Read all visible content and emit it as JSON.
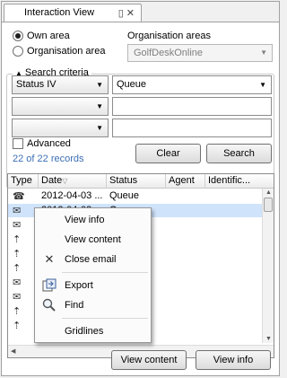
{
  "panel": {
    "tab_title": "Interaction View",
    "tab_pin_icon": "pin-icon",
    "tab_close_icon": "close-icon"
  },
  "area": {
    "own_area_label": "Own area",
    "organisation_area_label": "Organisation area",
    "selected": "own_area",
    "organisation_areas_label": "Organisation areas",
    "organisation_areas_value": "GolfDeskOnline"
  },
  "criteria": {
    "title": "Search criteria",
    "rows": [
      {
        "field": "Status IV",
        "value": "Queue"
      },
      {
        "field": "",
        "value": ""
      },
      {
        "field": "",
        "value": ""
      }
    ],
    "advanced_label": "Advanced",
    "advanced_checked": false,
    "records_text": "22 of 22 records",
    "clear_label": "Clear",
    "search_label": "Search"
  },
  "table": {
    "columns": [
      "Type",
      "Date",
      "Status",
      "Agent",
      "Identific..."
    ],
    "sort_column": "Date",
    "rows": [
      {
        "type_icon": "phone-icon",
        "date": "2012-04-03 ...",
        "status": "Queue",
        "selected": false
      },
      {
        "type_icon": "email-icon",
        "date": "2012-04-03",
        "status": "Queue",
        "selected": true
      },
      {
        "type_icon": "email-icon",
        "date": "",
        "status": "",
        "selected": false
      },
      {
        "type_icon": "incoming-icon",
        "date": "",
        "status": "",
        "selected": false
      },
      {
        "type_icon": "incoming-icon",
        "date": "",
        "status": "",
        "selected": false
      },
      {
        "type_icon": "incoming-icon",
        "date": "",
        "status": "",
        "selected": false
      },
      {
        "type_icon": "email-icon",
        "date": "",
        "status": "",
        "selected": false
      },
      {
        "type_icon": "email-icon",
        "date": "",
        "status": "",
        "selected": false
      },
      {
        "type_icon": "incoming-icon",
        "date": "",
        "status": "",
        "selected": false
      },
      {
        "type_icon": "incoming-icon",
        "date": "",
        "status": "",
        "selected": false
      }
    ]
  },
  "context_menu": {
    "items": [
      {
        "label": "View info",
        "icon": ""
      },
      {
        "label": "View content",
        "icon": ""
      },
      {
        "label": "Close email",
        "icon": "close-email-icon"
      },
      {
        "label": "Export",
        "icon": "export-icon"
      },
      {
        "label": "Find",
        "icon": "find-icon"
      },
      {
        "label": "Gridlines",
        "icon": ""
      }
    ]
  },
  "footer": {
    "view_content_label": "View content",
    "view_info_label": "View info"
  }
}
